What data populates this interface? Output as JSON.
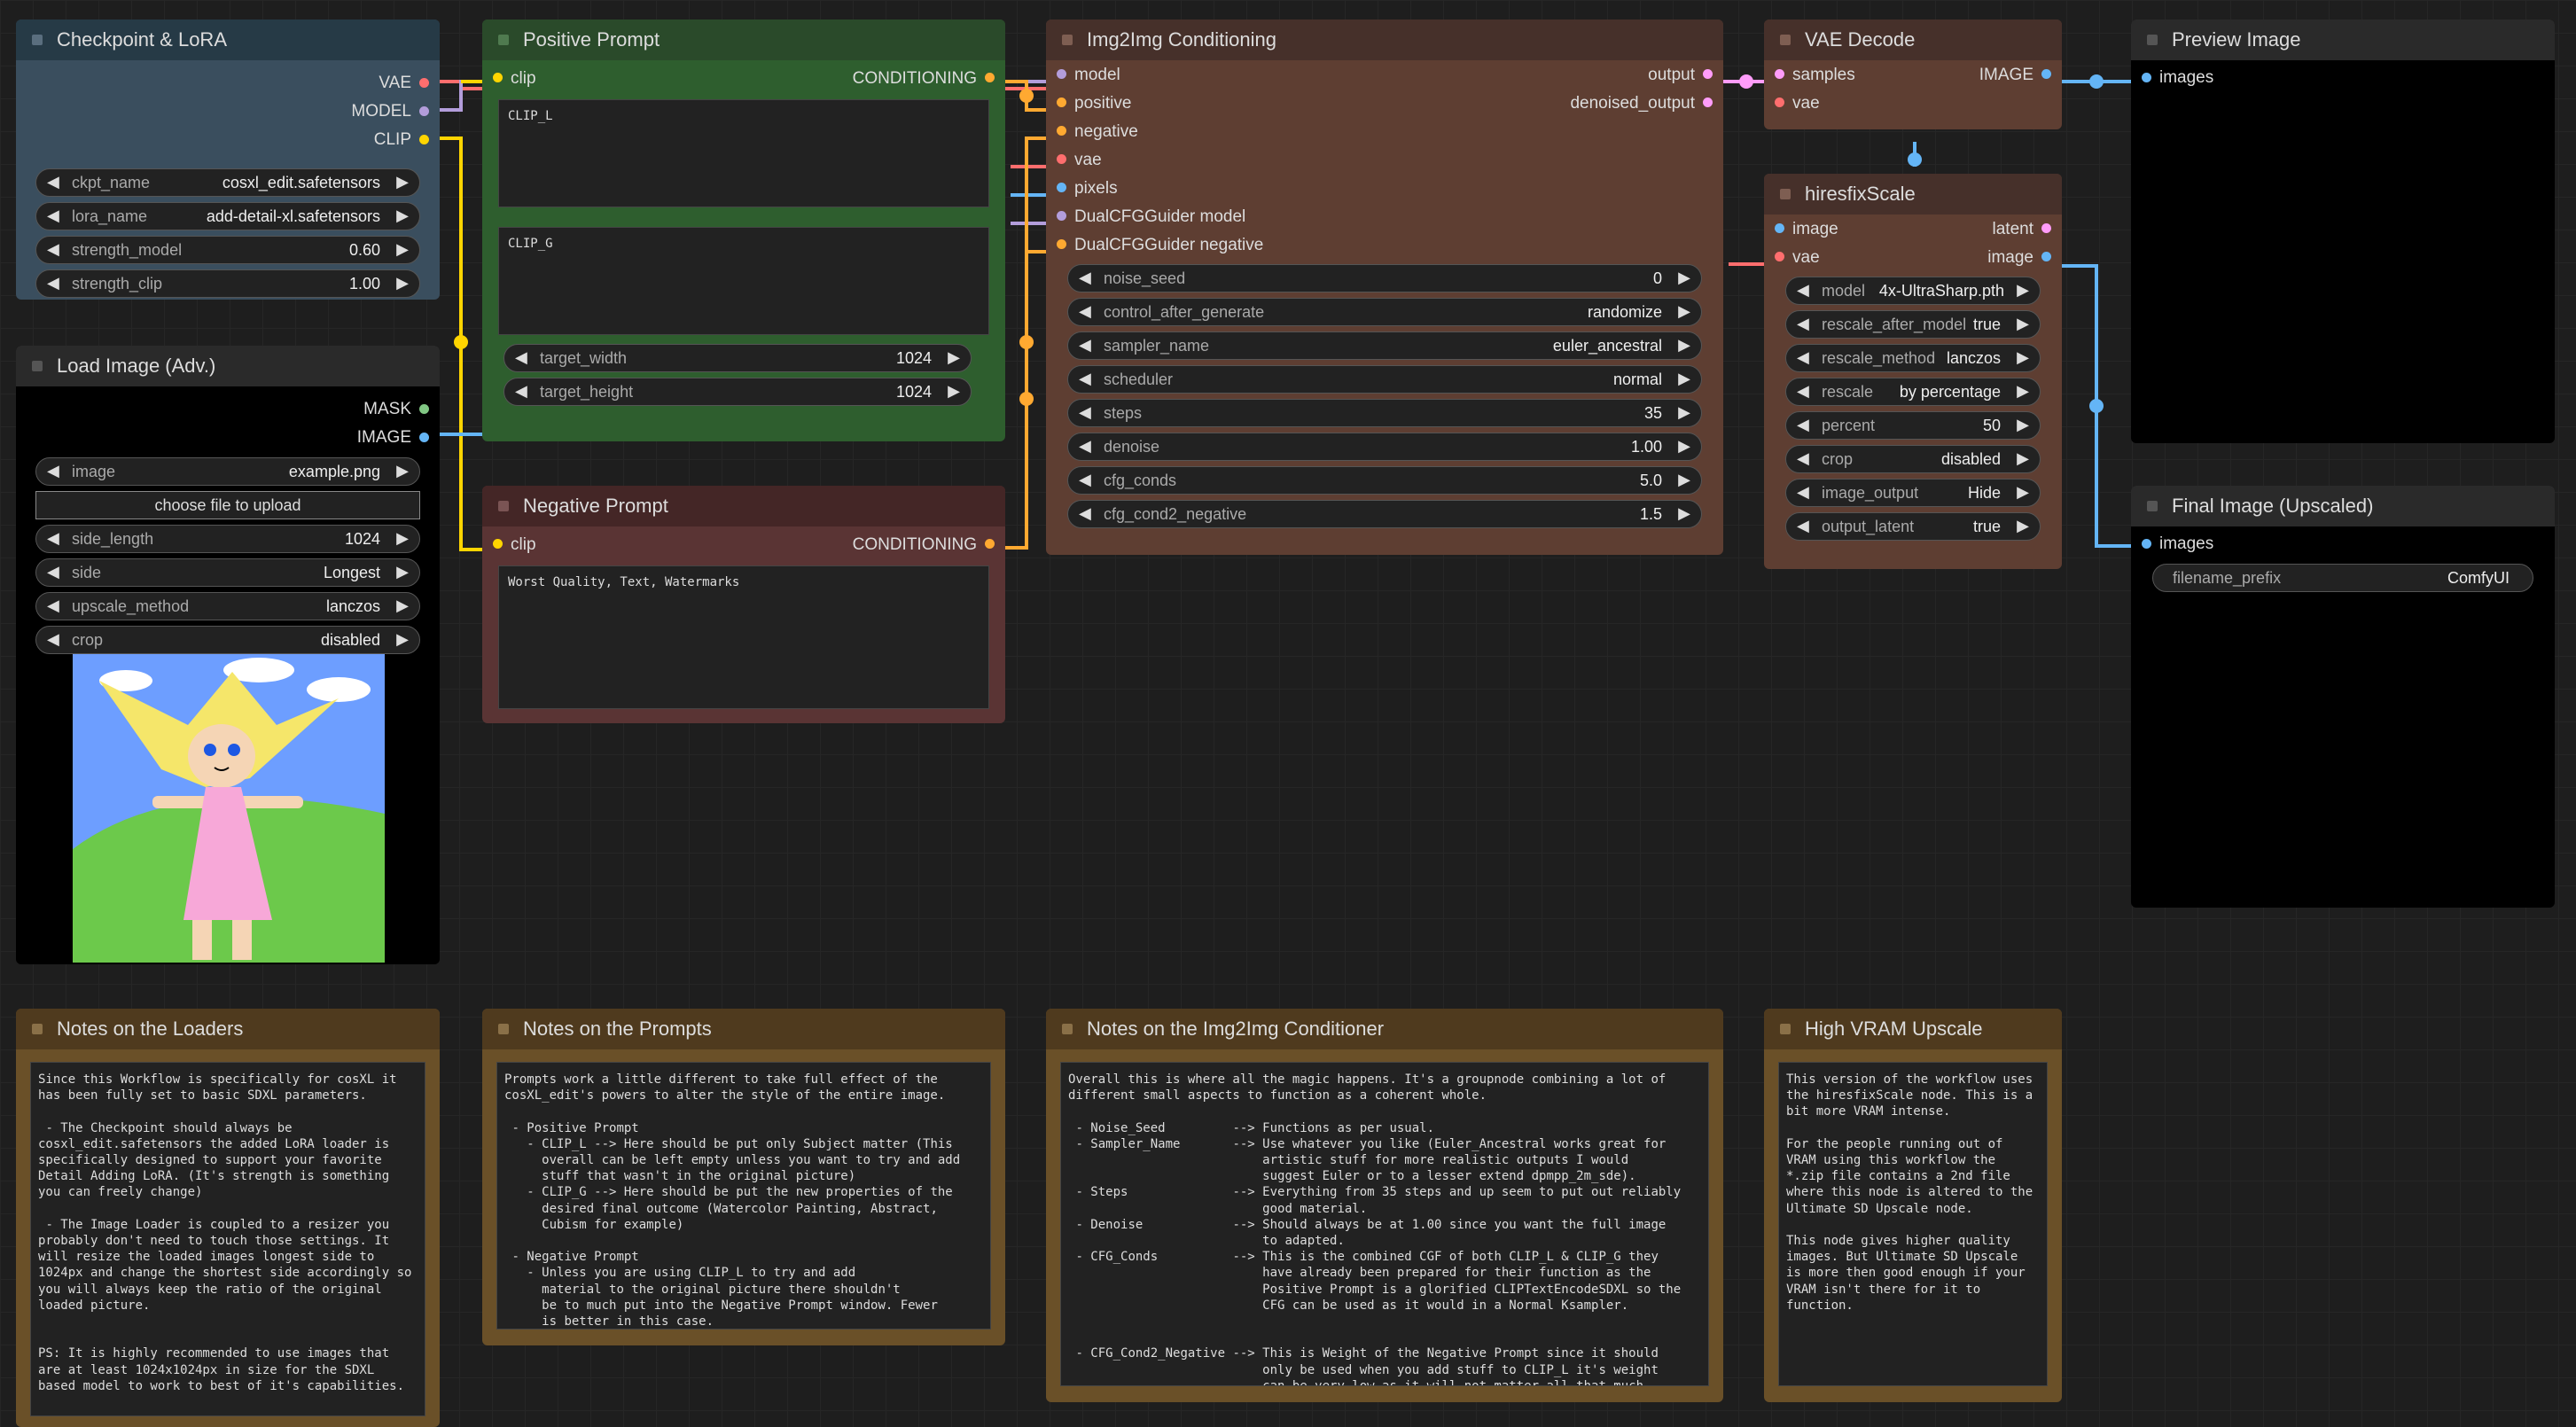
{
  "colors": {
    "canvas": "#1e1e1e",
    "loader_body": "#3a4e5e",
    "loader_title": "#263a46",
    "green_body": "#2e5e2e",
    "green_title": "#2a4a2a",
    "red_body": "#5a3434",
    "red_title": "#442626",
    "brown_body": "#5e3e32",
    "brown_title": "#46302a",
    "note_body": "#6a5028",
    "note_title": "#4f3a1e",
    "model_wire": "#b39ddb",
    "clip_wire": "#ffd500",
    "vae_wire": "#ff6e6e",
    "image_wire": "#64b5f6",
    "cond_wire": "#ffa931",
    "latent_wire": "#ff9cf9"
  },
  "checkpoint": {
    "title": "Checkpoint & LoRA",
    "outputs": [
      "VAE",
      "MODEL",
      "CLIP"
    ],
    "widgets": [
      {
        "name": "ckpt_name",
        "value": "cosxl_edit.safetensors"
      },
      {
        "name": "lora_name",
        "value": "add-detail-xl.safetensors"
      },
      {
        "name": "strength_model",
        "value": "0.60"
      },
      {
        "name": "strength_clip",
        "value": "1.00"
      }
    ]
  },
  "load_image": {
    "title": "Load Image (Adv.)",
    "outputs": [
      "MASK",
      "IMAGE"
    ],
    "widgets_a": [
      {
        "name": "image",
        "value": "example.png"
      }
    ],
    "upload_label": "choose file to upload",
    "widgets_b": [
      {
        "name": "side_length",
        "value": "1024"
      },
      {
        "name": "side",
        "value": "Longest"
      },
      {
        "name": "upscale_method",
        "value": "lanczos"
      },
      {
        "name": "crop",
        "value": "disabled"
      }
    ]
  },
  "positive": {
    "title": "Positive Prompt",
    "input": "clip",
    "output": "CONDITIONING",
    "clip_l": "CLIP_L",
    "clip_g": "CLIP_G",
    "widgets": [
      {
        "name": "target_width",
        "value": "1024"
      },
      {
        "name": "target_height",
        "value": "1024"
      }
    ]
  },
  "negative": {
    "title": "Negative Prompt",
    "input": "clip",
    "output": "CONDITIONING",
    "text": "Worst Quality, Text, Watermarks"
  },
  "img2img": {
    "title": "Img2Img Conditioning",
    "io": [
      {
        "in": "model",
        "out": "output"
      },
      {
        "in": "positive",
        "out": "denoised_output"
      },
      {
        "in": "negative",
        "out": ""
      },
      {
        "in": "vae",
        "out": ""
      },
      {
        "in": "pixels",
        "out": ""
      },
      {
        "in": "DualCFGGuider model",
        "out": ""
      },
      {
        "in": "DualCFGGuider negative",
        "out": ""
      }
    ],
    "widgets": [
      {
        "name": "noise_seed",
        "value": "0"
      },
      {
        "name": "control_after_generate",
        "value": "randomize"
      },
      {
        "name": "sampler_name",
        "value": "euler_ancestral"
      },
      {
        "name": "scheduler",
        "value": "normal"
      },
      {
        "name": "steps",
        "value": "35"
      },
      {
        "name": "denoise",
        "value": "1.00"
      },
      {
        "name": "cfg_conds",
        "value": "5.0"
      },
      {
        "name": "cfg_cond2_negative",
        "value": "1.5"
      }
    ]
  },
  "vae_decode": {
    "title": "VAE Decode",
    "io": [
      {
        "in": "samples",
        "out": "IMAGE"
      },
      {
        "in": "vae",
        "out": ""
      }
    ]
  },
  "hires": {
    "title": "hiresfixScale",
    "io": [
      {
        "in": "image",
        "out": "latent"
      },
      {
        "in": "vae",
        "out": "image"
      }
    ],
    "widgets": [
      {
        "name": "model",
        "value": "4x-UltraSharp.pth"
      },
      {
        "name": "rescale_after_model",
        "value": "true"
      },
      {
        "name": "rescale_method",
        "value": "lanczos"
      },
      {
        "name": "rescale",
        "value": "by percentage"
      },
      {
        "name": "percent",
        "value": "50"
      },
      {
        "name": "crop",
        "value": "disabled"
      },
      {
        "name": "image_output",
        "value": "Hide"
      },
      {
        "name": "output_latent",
        "value": "true"
      }
    ]
  },
  "preview": {
    "title": "Preview Image",
    "input": "images"
  },
  "final": {
    "title": "Final Image (Upscaled)",
    "input": "images",
    "widget": {
      "name": "filename_prefix",
      "value": "ComfyUI"
    }
  },
  "notes": [
    {
      "title": "Notes on the Loaders",
      "text": "Since this Workflow is specifically for cosXL it\nhas been fully set to basic SDXL parameters.\n\n - The Checkpoint should always be\ncosxl_edit.safetensors the added LoRA loader is\nspecifically designed to support your favorite\nDetail Adding LoRA. (It's strength is something\nyou can freely change)\n\n - The Image Loader is coupled to a resizer you\nprobably don't need to touch those settings. It\nwill resize the loaded images longest side to\n1024px and change the shortest side accordingly so\nyou will always keep the ratio of the original\nloaded picture.\n\n\nPS: It is highly recommended to use images that\nare at least 1024x1024px in size for the SDXL\nbased model to work to best of it's capabilities."
    },
    {
      "title": "Notes on the Prompts",
      "text": "Prompts work a little different to take full effect of the\ncosXL_edit's powers to alter the style of the entire image.\n\n - Positive Prompt\n   - CLIP_L --> Here should be put only Subject matter (This\n     overall can be left empty unless you want to try and add\n     stuff that wasn't in the original picture)\n   - CLIP_G --> Here should be put the new properties of the\n     desired final outcome (Watercolor Painting, Abstract,\n     Cubism for example)\n\n - Negative Prompt\n   - Unless you are using CLIP_L to try and add\n     material to the original picture there shouldn't\n     be to much put into the Negative Prompt window. Fewer\n     is better in this case."
    },
    {
      "title": "Notes on the Img2Img Conditioner",
      "text": "Overall this is where all the magic happens. It's a groupnode combining a lot of\ndifferent small aspects to function as a coherent whole.\n\n - Noise_Seed         --> Functions as per usual.\n - Sampler_Name       --> Use whatever you like (Euler_Ancestral works great for\n                          artistic stuff for more realistic outputs I would\n                          suggest Euler or to a lesser extend dpmpp_2m_sde).\n - Steps              --> Everything from 35 steps and up seem to put out reliably\n                          good material.\n - Denoise            --> Should always be at 1.00 since you want the full image\n                          to adapted.\n - CFG_Conds          --> This is the combined CGF of both CLIP_L & CLIP_G they\n                          have already been prepared for their function as the\n                          Positive Prompt is a glorified CLIPTextEncodeSDXL so the\n                          CFG can be used as it would in a Normal Ksampler.\n\n\n - CFG_Cond2_Negative --> This is Weight of the Negative Prompt since it should\n                          only be used when you add stuff to CLIP_L it's weight\n                          can be very low as it will not matter all that much."
    },
    {
      "title": "High VRAM Upscale",
      "text": "This version of the workflow uses\nthe hiresfixScale node. This is a\nbit more VRAM intense.\n\nFor the people running out of\nVRAM using this workflow the\n*.zip file contains a 2nd file\nwhere this node is altered to the\nUltimate SD Upscale node.\n\nThis node gives higher quality\nimages. But Ultimate SD Upscale\nis more then good enough if your\nVRAM isn't there for it to\nfunction."
    }
  ]
}
